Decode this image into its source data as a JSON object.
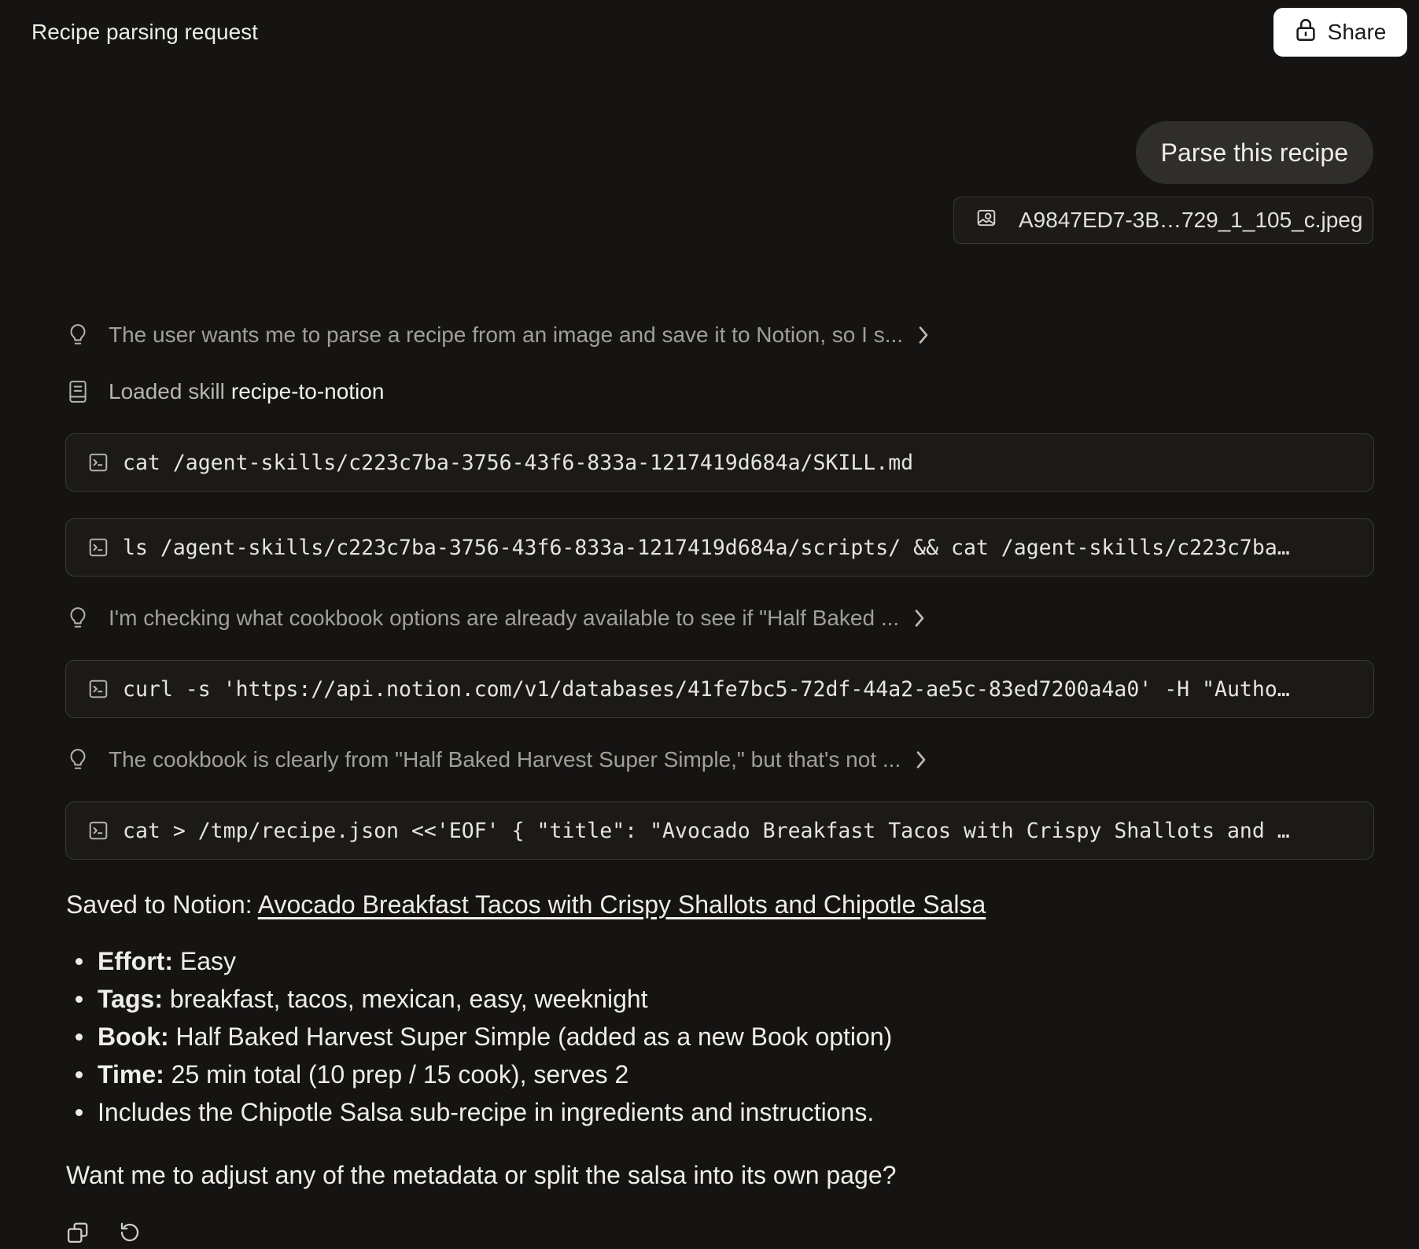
{
  "header": {
    "title": "Recipe parsing request",
    "share_label": "Share",
    "share_icon": "lock-icon"
  },
  "user_message": {
    "text": "Parse this recipe",
    "attachment": {
      "filename": "A9847ED7-3B…729_1_105_c.jpeg",
      "icon": "image-icon"
    }
  },
  "steps": [
    {
      "type": "thought",
      "icon": "lightbulb-icon",
      "text": "The user wants me to parse a recipe from an image and save it to Notion, so I s..."
    },
    {
      "type": "skill",
      "icon": "book-icon",
      "prefix": "Loaded skill",
      "name": "recipe-to-notion"
    },
    {
      "type": "command",
      "icon": "terminal-icon",
      "text": "cat /agent-skills/c223c7ba-3756-43f6-833a-1217419d684a/SKILL.md"
    },
    {
      "type": "command",
      "icon": "terminal-icon",
      "text": "ls /agent-skills/c223c7ba-3756-43f6-833a-1217419d684a/scripts/ && cat /agent-skills/c223c7ba…"
    },
    {
      "type": "thought",
      "icon": "lightbulb-icon",
      "text": "I'm checking what cookbook options are already available to see if \"Half Baked ..."
    },
    {
      "type": "command",
      "icon": "terminal-icon",
      "text": "curl -s 'https://api.notion.com/v1/databases/41fe7bc5-72df-44a2-ae5c-83ed7200a4a0' -H \"Autho…"
    },
    {
      "type": "thought",
      "icon": "lightbulb-icon",
      "text": "The cookbook is clearly from \"Half Baked Harvest Super Simple,\" but that's not ..."
    },
    {
      "type": "command",
      "icon": "terminal-icon",
      "text": "cat > /tmp/recipe.json <<'EOF' { \"title\": \"Avocado Breakfast Tacos with Crispy Shallots and …"
    }
  ],
  "response": {
    "saved_prefix": "Saved to Notion: ",
    "saved_link": "Avocado Breakfast Tacos with Crispy Shallots and Chipotle Salsa",
    "bullets": [
      {
        "label": "Effort:",
        "value": " Easy"
      },
      {
        "label": "Tags:",
        "value": " breakfast, tacos, mexican, easy, weeknight"
      },
      {
        "label": "Book:",
        "value": " Half Baked Harvest Super Simple (added as a new Book option)"
      },
      {
        "label": "Time:",
        "value": " 25 min total (10 prep / 15 cook), serves 2"
      },
      {
        "label": "",
        "value": "Includes the Chipotle Salsa sub-recipe in ingredients and instructions."
      }
    ],
    "followup": "Want me to adjust any of the metadata or split the salsa into its own page?"
  },
  "actions": [
    {
      "name": "copy-icon"
    },
    {
      "name": "retry-icon"
    }
  ],
  "colors": {
    "background": "#151413",
    "text": "#efede8",
    "muted": "#a19f99",
    "border": "#3a3936",
    "bubble": "#2f2e2b",
    "share_bg": "#ffffff"
  }
}
